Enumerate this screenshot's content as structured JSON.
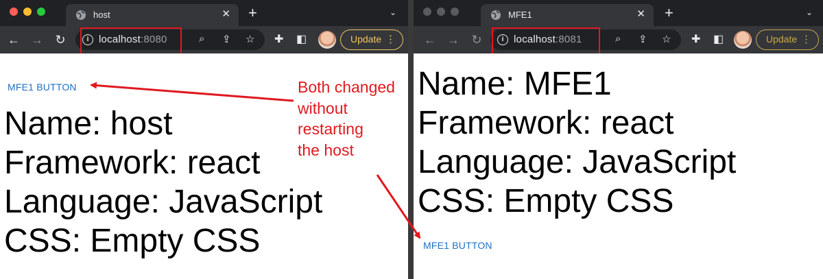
{
  "left_window": {
    "tab_title": "host",
    "url_host": "localhost",
    "url_port": ":8080",
    "update_label": "Update",
    "button_label": "MFE1 BUTTON",
    "lines": [
      "Name: host",
      "Framework: react",
      "Language: JavaScript",
      "CSS: Empty CSS"
    ]
  },
  "right_window": {
    "tab_title": "MFE1",
    "url_host": "localhost",
    "url_port": ":8081",
    "update_label": "Update",
    "button_label": "MFE1 BUTTON",
    "lines": [
      "Name: MFE1",
      "Framework: react",
      "Language: JavaScript",
      "CSS: Empty CSS"
    ]
  },
  "annotation": {
    "lines": [
      "Both changed",
      "without",
      "restarting",
      "the host"
    ],
    "color": "#e0191f"
  },
  "colors": {
    "tab_bg": "#202124",
    "toolbar_bg": "#35363a",
    "link_blue": "#1d6fc4",
    "update_yellow": "#f0c75e",
    "highlight_red": "#e0191f"
  }
}
